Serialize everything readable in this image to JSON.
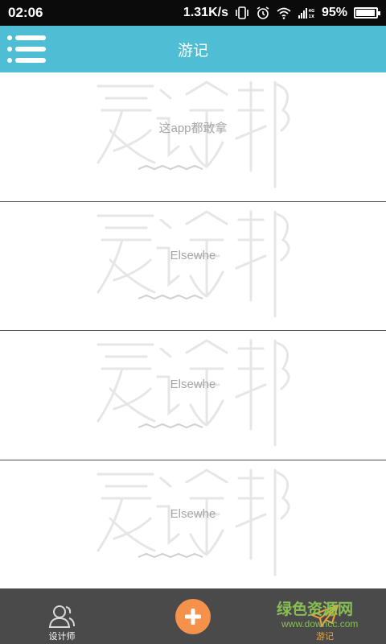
{
  "status_bar": {
    "time": "02:06",
    "speed": "1.31K/s",
    "network_label": "4G 1X",
    "battery": "95%",
    "battery_level": 0.95
  },
  "header": {
    "title": "游记",
    "background_color": "#4fbdd3"
  },
  "cards": [
    {
      "title": "这app都敢拿",
      "logo_icon": "aitubang-logo"
    },
    {
      "title": "Elsewhe",
      "logo_icon": "aitubang-logo"
    },
    {
      "title": "Elsewhe",
      "logo_icon": "aitubang-logo"
    },
    {
      "title": "Elsewhe",
      "logo_icon": "aitubang-logo"
    }
  ],
  "bottom_nav": {
    "designers_label": "设计师",
    "travel_label": "游记",
    "accent_color": "#f4914a",
    "active_color": "#f0a23c"
  },
  "watermark": {
    "text": "绿色资源网",
    "url": "www.downcc.com"
  }
}
